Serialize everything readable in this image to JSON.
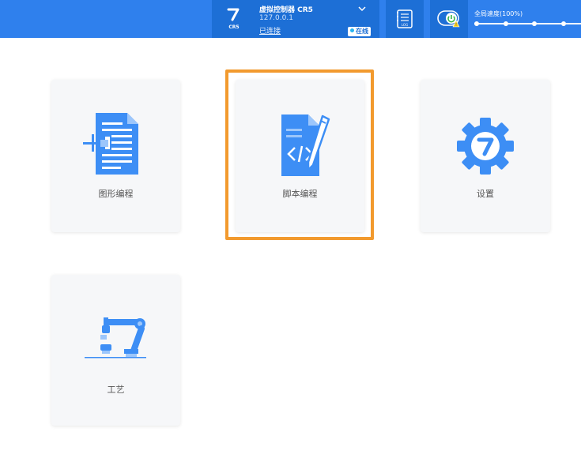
{
  "topbar": {
    "robot_model": "CR5",
    "controller_name": "虚拟控制器 CR5",
    "controller_ip": "127.0.0.1",
    "connection_status": "已连接",
    "online_status": "在线",
    "speed_label": "全局速度(100%)",
    "global_speed_percent": 100
  },
  "cards": [
    {
      "label": "图形编程",
      "icon": "graphic-programming-icon"
    },
    {
      "label": "脚本编程",
      "icon": "script-programming-icon"
    },
    {
      "label": "设置",
      "icon": "settings-gear-icon"
    },
    {
      "label": "工艺",
      "icon": "robot-arm-process-icon"
    }
  ],
  "colors": {
    "topbar": "#2f80ed",
    "topbar_block": "#1d6fd6",
    "icon_blue": "#3d8ef5",
    "highlight": "#f29a2e",
    "card_bg": "#f6f7f9"
  }
}
